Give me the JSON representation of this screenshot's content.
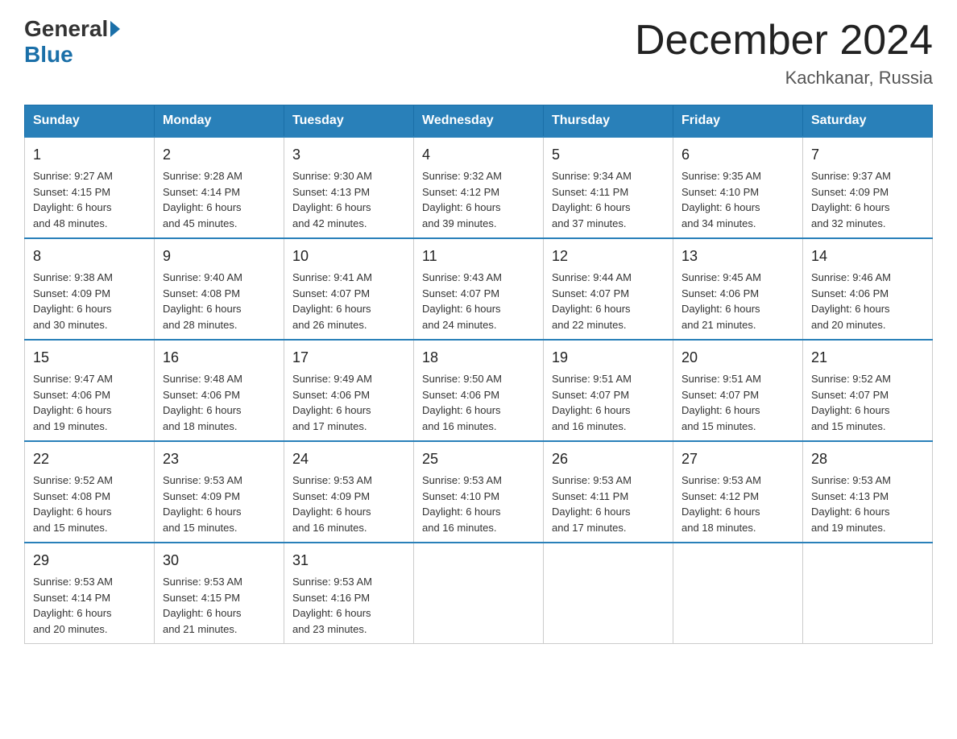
{
  "logo": {
    "text_general": "General",
    "text_blue": "Blue"
  },
  "header": {
    "month": "December 2024",
    "location": "Kachkanar, Russia"
  },
  "days_of_week": [
    "Sunday",
    "Monday",
    "Tuesday",
    "Wednesday",
    "Thursday",
    "Friday",
    "Saturday"
  ],
  "weeks": [
    [
      {
        "day": "1",
        "sunrise": "9:27 AM",
        "sunset": "4:15 PM",
        "daylight": "6 hours and 48 minutes."
      },
      {
        "day": "2",
        "sunrise": "9:28 AM",
        "sunset": "4:14 PM",
        "daylight": "6 hours and 45 minutes."
      },
      {
        "day": "3",
        "sunrise": "9:30 AM",
        "sunset": "4:13 PM",
        "daylight": "6 hours and 42 minutes."
      },
      {
        "day": "4",
        "sunrise": "9:32 AM",
        "sunset": "4:12 PM",
        "daylight": "6 hours and 39 minutes."
      },
      {
        "day": "5",
        "sunrise": "9:34 AM",
        "sunset": "4:11 PM",
        "daylight": "6 hours and 37 minutes."
      },
      {
        "day": "6",
        "sunrise": "9:35 AM",
        "sunset": "4:10 PM",
        "daylight": "6 hours and 34 minutes."
      },
      {
        "day": "7",
        "sunrise": "9:37 AM",
        "sunset": "4:09 PM",
        "daylight": "6 hours and 32 minutes."
      }
    ],
    [
      {
        "day": "8",
        "sunrise": "9:38 AM",
        "sunset": "4:09 PM",
        "daylight": "6 hours and 30 minutes."
      },
      {
        "day": "9",
        "sunrise": "9:40 AM",
        "sunset": "4:08 PM",
        "daylight": "6 hours and 28 minutes."
      },
      {
        "day": "10",
        "sunrise": "9:41 AM",
        "sunset": "4:07 PM",
        "daylight": "6 hours and 26 minutes."
      },
      {
        "day": "11",
        "sunrise": "9:43 AM",
        "sunset": "4:07 PM",
        "daylight": "6 hours and 24 minutes."
      },
      {
        "day": "12",
        "sunrise": "9:44 AM",
        "sunset": "4:07 PM",
        "daylight": "6 hours and 22 minutes."
      },
      {
        "day": "13",
        "sunrise": "9:45 AM",
        "sunset": "4:06 PM",
        "daylight": "6 hours and 21 minutes."
      },
      {
        "day": "14",
        "sunrise": "9:46 AM",
        "sunset": "4:06 PM",
        "daylight": "6 hours and 20 minutes."
      }
    ],
    [
      {
        "day": "15",
        "sunrise": "9:47 AM",
        "sunset": "4:06 PM",
        "daylight": "6 hours and 19 minutes."
      },
      {
        "day": "16",
        "sunrise": "9:48 AM",
        "sunset": "4:06 PM",
        "daylight": "6 hours and 18 minutes."
      },
      {
        "day": "17",
        "sunrise": "9:49 AM",
        "sunset": "4:06 PM",
        "daylight": "6 hours and 17 minutes."
      },
      {
        "day": "18",
        "sunrise": "9:50 AM",
        "sunset": "4:06 PM",
        "daylight": "6 hours and 16 minutes."
      },
      {
        "day": "19",
        "sunrise": "9:51 AM",
        "sunset": "4:07 PM",
        "daylight": "6 hours and 16 minutes."
      },
      {
        "day": "20",
        "sunrise": "9:51 AM",
        "sunset": "4:07 PM",
        "daylight": "6 hours and 15 minutes."
      },
      {
        "day": "21",
        "sunrise": "9:52 AM",
        "sunset": "4:07 PM",
        "daylight": "6 hours and 15 minutes."
      }
    ],
    [
      {
        "day": "22",
        "sunrise": "9:52 AM",
        "sunset": "4:08 PM",
        "daylight": "6 hours and 15 minutes."
      },
      {
        "day": "23",
        "sunrise": "9:53 AM",
        "sunset": "4:09 PM",
        "daylight": "6 hours and 15 minutes."
      },
      {
        "day": "24",
        "sunrise": "9:53 AM",
        "sunset": "4:09 PM",
        "daylight": "6 hours and 16 minutes."
      },
      {
        "day": "25",
        "sunrise": "9:53 AM",
        "sunset": "4:10 PM",
        "daylight": "6 hours and 16 minutes."
      },
      {
        "day": "26",
        "sunrise": "9:53 AM",
        "sunset": "4:11 PM",
        "daylight": "6 hours and 17 minutes."
      },
      {
        "day": "27",
        "sunrise": "9:53 AM",
        "sunset": "4:12 PM",
        "daylight": "6 hours and 18 minutes."
      },
      {
        "day": "28",
        "sunrise": "9:53 AM",
        "sunset": "4:13 PM",
        "daylight": "6 hours and 19 minutes."
      }
    ],
    [
      {
        "day": "29",
        "sunrise": "9:53 AM",
        "sunset": "4:14 PM",
        "daylight": "6 hours and 20 minutes."
      },
      {
        "day": "30",
        "sunrise": "9:53 AM",
        "sunset": "4:15 PM",
        "daylight": "6 hours and 21 minutes."
      },
      {
        "day": "31",
        "sunrise": "9:53 AM",
        "sunset": "4:16 PM",
        "daylight": "6 hours and 23 minutes."
      },
      null,
      null,
      null,
      null
    ]
  ]
}
